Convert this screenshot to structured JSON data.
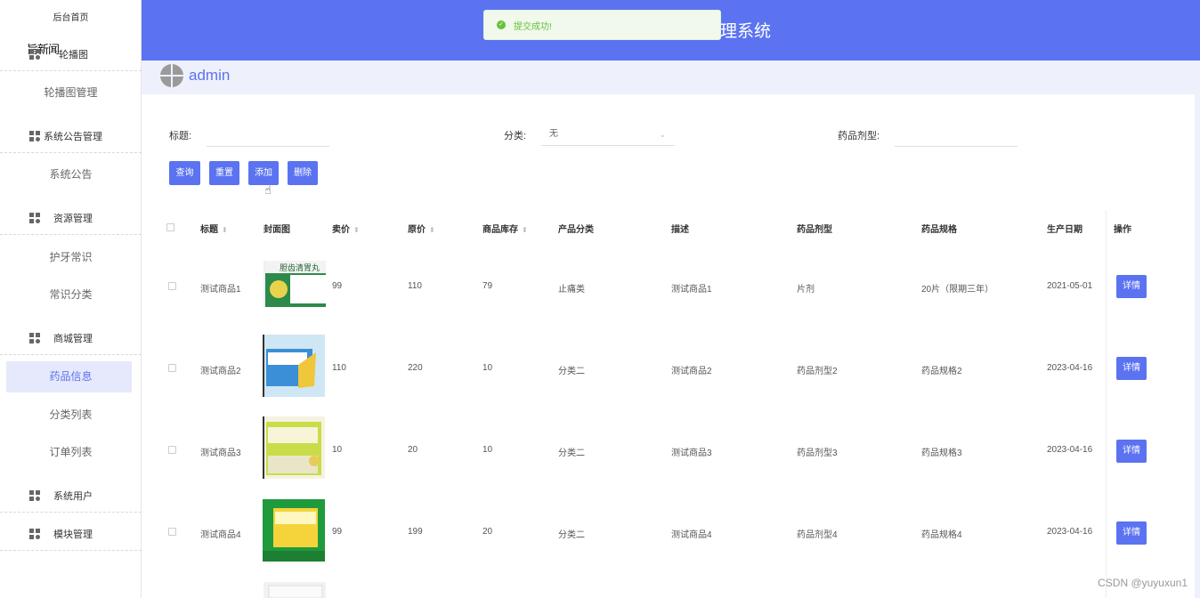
{
  "header": {
    "title": "理系统"
  },
  "toast": {
    "message": "提交成功!"
  },
  "user": {
    "name": "admin"
  },
  "sidebar": {
    "home": "后台首页",
    "overlap": "旨新闻",
    "groups": [
      {
        "label": "轮播图",
        "icon": "grid-icon"
      },
      {
        "label": "系统公告管理",
        "icon": "grid-icon"
      },
      {
        "label": "资源管理",
        "icon": "grid-icon"
      },
      {
        "label": "商城管理",
        "icon": "grid-icon"
      },
      {
        "label": "系统用户",
        "icon": "grid-icon"
      },
      {
        "label": "模块管理",
        "icon": "grid-icon"
      }
    ],
    "items": [
      "轮播图管理",
      "系统公告",
      "护牙常识",
      "常识分类",
      "药品信息",
      "分类列表",
      "订单列表"
    ]
  },
  "filters": {
    "title_label": "标题:",
    "category_label": "分类:",
    "category_value": "无",
    "dosage_label": "药品剂型:"
  },
  "buttons": {
    "query": "查询",
    "reset": "重置",
    "add": "添加",
    "delete": "删除"
  },
  "table": {
    "headers": [
      "标题",
      "封面图",
      "卖价",
      "原价",
      "商品库存",
      "产品分类",
      "描述",
      "药品剂型",
      "药品规格",
      "生产日期",
      "操作"
    ],
    "rows": [
      {
        "title": "测试商品1",
        "price": "99",
        "orig": "110",
        "stock": "79",
        "category": "止痛类",
        "desc": "测试商品1",
        "dosage": "片剂",
        "spec": "20片（限期三年）",
        "date": "2021-05-01",
        "action": "详情",
        "img_text": "胆齿清胃丸"
      },
      {
        "title": "测试商品2",
        "price": "110",
        "orig": "220",
        "stock": "10",
        "category": "分类二",
        "desc": "测试商品2",
        "dosage": "药品剂型2",
        "spec": "药品规格2",
        "date": "2023-04-16",
        "action": "详情",
        "img_text": ""
      },
      {
        "title": "测试商品3",
        "price": "10",
        "orig": "20",
        "stock": "10",
        "category": "分类二",
        "desc": "测试商品3",
        "dosage": "药品剂型3",
        "spec": "药品规格3",
        "date": "2023-04-16",
        "action": "详情",
        "img_text": ""
      },
      {
        "title": "测试商品4",
        "price": "99",
        "orig": "199",
        "stock": "20",
        "category": "分类二",
        "desc": "测试商品4",
        "dosage": "药品剂型4",
        "spec": "药品规格4",
        "date": "2023-04-16",
        "action": "详情",
        "img_text": ""
      }
    ]
  },
  "watermark": "CSDN @yuyuxun1",
  "colors": {
    "primary": "#5b73f0",
    "success": "#67c23a",
    "sidebar_active": "#e6e9fb"
  }
}
